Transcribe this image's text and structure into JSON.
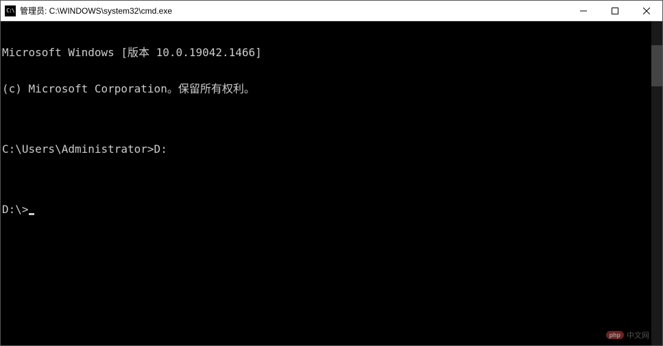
{
  "titlebar": {
    "icon_text": "C:\\",
    "title": "管理员: C:\\WINDOWS\\system32\\cmd.exe"
  },
  "terminal": {
    "lines": [
      "Microsoft Windows [版本 10.0.19042.1466]",
      "(c) Microsoft Corporation。保留所有权利。",
      "",
      "C:\\Users\\Administrator>D:",
      "",
      "D:\\>"
    ]
  },
  "watermark": {
    "badge": "php",
    "text": "中文网"
  }
}
